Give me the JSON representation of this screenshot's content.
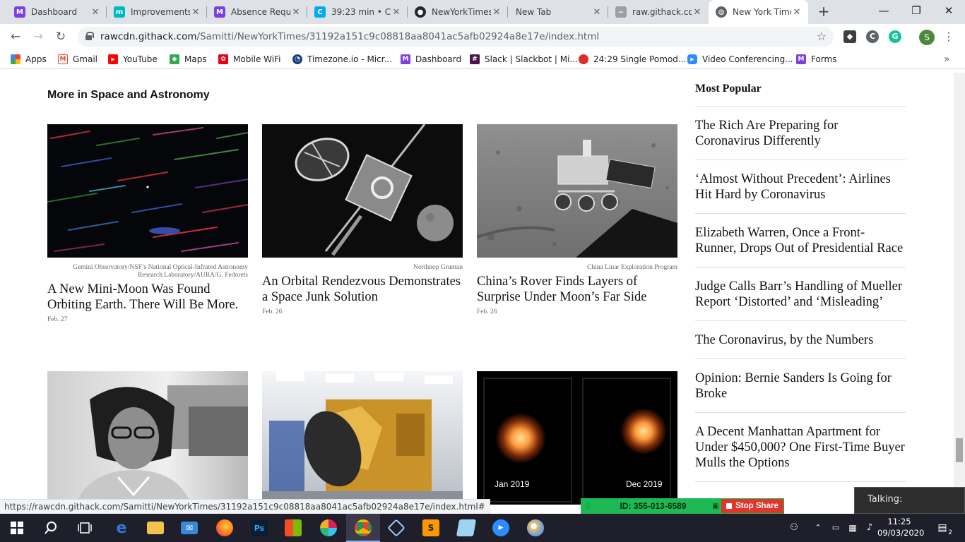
{
  "browser": {
    "tabs": [
      {
        "title": "Dashboard",
        "icon": "dashboard-favicon",
        "color": "#7b3fe4",
        "glyph": "M"
      },
      {
        "title": "Improvements",
        "icon": "m-favicon",
        "color": "#00b9c6",
        "glyph": "m"
      },
      {
        "title": "Absence Requ",
        "icon": "dashboard-favicon",
        "color": "#7b3fe4",
        "glyph": "M"
      },
      {
        "title": "39:23 min • Cl",
        "icon": "clockify-favicon",
        "color": "#03a9f4",
        "glyph": "C"
      },
      {
        "title": "NewYorkTimes",
        "icon": "github-favicon",
        "color": "#24292e",
        "glyph": "●"
      },
      {
        "title": "New Tab",
        "icon": "",
        "color": "",
        "glyph": ""
      },
      {
        "title": "raw.githack.co",
        "icon": "githack-favicon",
        "color": "#9aa0a6",
        "glyph": "~"
      },
      {
        "title": "New York Time",
        "icon": "globe-favicon",
        "color": "#5f6368",
        "glyph": "◍"
      }
    ],
    "new_tab_glyph": "+",
    "window_controls": {
      "minimize": "—",
      "restore": "❐",
      "close": "✕"
    },
    "nav": {
      "back": "←",
      "forward": "→",
      "reload": "↻"
    },
    "url_host": "rawcdn.githack.com",
    "url_path": "/Samitti/NewYorkTimes/31192a151c9c08818aa8041ac5afb02924a8e17e/index.html",
    "star_glyph": "☆",
    "profile_initial": "S",
    "menu_glyph": "⋮",
    "bookmarks": [
      {
        "label": "Apps",
        "icon": "apps-grid-icon",
        "color": "#ea4335",
        "glyph": "⁞"
      },
      {
        "label": "Gmail",
        "icon": "gmail-icon",
        "color": "#ea4335",
        "glyph": "M"
      },
      {
        "label": "YouTube",
        "icon": "youtube-icon",
        "color": "#ff0000",
        "glyph": "▶"
      },
      {
        "label": "Maps",
        "icon": "maps-icon",
        "color": "#34a853",
        "glyph": "◆"
      },
      {
        "label": "Mobile WiFi",
        "icon": "huawei-icon",
        "color": "#e60012",
        "glyph": "✿"
      },
      {
        "label": "Timezone.io - Micr...",
        "icon": "timezone-icon",
        "color": "#1a3d7c",
        "glyph": "◔"
      },
      {
        "label": "Dashboard",
        "icon": "dashboard-icon",
        "color": "#7b3fe4",
        "glyph": "M"
      },
      {
        "label": "Slack | Slackbot | Mi...",
        "icon": "slack-icon",
        "color": "#4a154b",
        "glyph": "#"
      },
      {
        "label": "24:29 Single Pomod...",
        "icon": "tomato-icon",
        "color": "#d93025",
        "glyph": "●"
      },
      {
        "label": "Video Conferencing...",
        "icon": "zoom-icon",
        "color": "#2d8cff",
        "glyph": "▶"
      },
      {
        "label": "Forms",
        "icon": "dashboard-icon",
        "color": "#7b3fe4",
        "glyph": "M"
      }
    ],
    "bookmarks_more": "»"
  },
  "page": {
    "section_title": "More in Space and Astronomy",
    "cards": [
      {
        "credit": "Gemini Observatory/NSF’s National Optical-Infrared Astronomy Research Laboratory/AURA/G. Fedorets",
        "headline": "A New Mini-Moon Was Found Orbiting Earth. There Will Be More.",
        "date": "Feb. 27",
        "image": "star-trails-image"
      },
      {
        "credit": "Northnop Gruman",
        "headline": "An Orbital Rendezvous Demonstrates a Space Junk Solution",
        "date": "Feb. 26",
        "image": "satellite-image"
      },
      {
        "credit": "China Linar Exploration Program",
        "headline": "China’s Rover Finds Layers of Surprise Under Moon’s Far Side",
        "date": "Feb. 26",
        "image": "moon-rover-image"
      },
      {
        "image": "portrait-image"
      },
      {
        "image": "spacecraft-image"
      },
      {
        "image": "betelgeuse-image",
        "labels": [
          "Jan 2019",
          "Dec 2019"
        ]
      }
    ],
    "most_popular": {
      "title": "Most Popular",
      "items": [
        "The Rich Are Preparing for Coronavirus Differently",
        "‘Almost Without Precedent’: Airlines Hit Hard by Coronavirus",
        "Elizabeth Warren, Once a Front-Runner, Drops Out of Presidential Race",
        "Judge Calls Barr’s Handling of Mueller Report ‘Distorted’ and ‘Misleading’",
        "The Coronavirus, by the Numbers",
        "Opinion: Bernie Sanders Is Going for Broke",
        "A Decent Manhattan Apartment for Under $450,000? One First-Time Buyer Mulls the Options"
      ]
    }
  },
  "status_url": "https://rawcdn.githack.com/Samitti/NewYorkTimes/31192a151c9c08818aa8041ac5afb02924a8e17e/index.html#",
  "zoom": {
    "meeting_id": "ID: 355-013-6589",
    "stop_share": "Stop Share",
    "talking": "Talking:"
  },
  "taskbar": {
    "apps": [
      {
        "name": "start-icon"
      },
      {
        "name": "search-icon"
      },
      {
        "name": "task-view-icon"
      },
      {
        "name": "edge-icon"
      },
      {
        "name": "file-explorer-icon"
      },
      {
        "name": "mail-icon"
      },
      {
        "name": "firefox-icon"
      },
      {
        "name": "photoshop-icon"
      },
      {
        "name": "store-icon"
      },
      {
        "name": "slack-icon"
      },
      {
        "name": "chrome-icon"
      },
      {
        "name": "virtualbox-icon"
      },
      {
        "name": "sublime-icon"
      },
      {
        "name": "notepad-icon"
      },
      {
        "name": "zoom-icon"
      },
      {
        "name": "paint-icon"
      }
    ],
    "time": "11:25",
    "date": "09/03/2020",
    "notifications": "2"
  }
}
